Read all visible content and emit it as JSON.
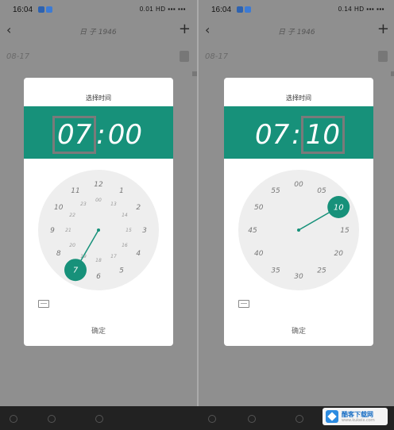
{
  "screens": [
    {
      "status_time": "16:04",
      "status_right": "0.01 HD ▪▪▪ ▪▪▪",
      "app_title": "日 子 1946",
      "bg_date": "08-17",
      "dialog": {
        "title": "选择时间",
        "hour": "07",
        "minute": "00",
        "separator": ":",
        "mode": "hour",
        "selected_label": "7",
        "selected_angle_deg": 210,
        "confirm_label": "确定"
      },
      "outer_labels": [
        "12",
        "1",
        "2",
        "3",
        "4",
        "5",
        "6",
        "7",
        "8",
        "9",
        "10",
        "11"
      ],
      "inner_labels": [
        "00",
        "13",
        "14",
        "15",
        "16",
        "17",
        "18",
        "19",
        "20",
        "21",
        "22",
        "23"
      ]
    },
    {
      "status_time": "16:04",
      "status_right": "0.14 HD ▪▪▪ ▪▪▪",
      "app_title": "日 子 1946",
      "bg_date": "08-17",
      "dialog": {
        "title": "选择时间",
        "hour": "07",
        "minute": "10",
        "separator": ":",
        "mode": "minute",
        "selected_label": "10",
        "selected_angle_deg": 60,
        "confirm_label": "确定"
      },
      "outer_labels": [
        "00",
        "05",
        "10",
        "15",
        "20",
        "25",
        "30",
        "35",
        "40",
        "45",
        "50",
        "55"
      ]
    }
  ],
  "colors": {
    "accent": "#17917a",
    "dialog_bg": "#ffffff",
    "clock_bg": "#eeeeee",
    "overlay": "#8f8f8f",
    "selection_box": "#7a7a7a"
  },
  "watermark": {
    "text": "酷客下载网",
    "sub": "www.kukeix.com"
  },
  "icons": {
    "back": "chevron-left-icon",
    "add": "plus-icon",
    "keyboard": "keyboard-icon"
  }
}
